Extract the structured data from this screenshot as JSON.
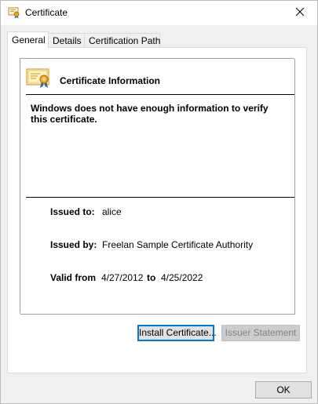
{
  "window": {
    "title": "Certificate",
    "close_glyph": "✕"
  },
  "tabs": [
    {
      "label": "General",
      "active": true
    },
    {
      "label": "Details",
      "active": false
    },
    {
      "label": "Certification Path",
      "active": false
    }
  ],
  "info": {
    "heading": "Certificate Information",
    "warning": "Windows does not have enough information to verify this certificate.",
    "issued_to_label": "Issued to:",
    "issued_to_value": "alice",
    "issued_by_label": "Issued by:",
    "issued_by_value": "Freelan Sample Certificate Authority",
    "valid_from_label": "Valid from",
    "valid_from_value": "4/27/2012",
    "valid_to_label": "to",
    "valid_to_value": "4/25/2022"
  },
  "buttons": {
    "install_label": "Install Certificate...",
    "issuer_label": "Issuer Statement",
    "ok_label": "OK"
  },
  "icons": {
    "title": "certificate-icon",
    "close": "close-icon",
    "info": "certificate-ribbon-icon"
  },
  "colors": {
    "accent": "#0078d7",
    "window_bg": "#f0f0f0",
    "panel_bg": "#ffffff"
  }
}
